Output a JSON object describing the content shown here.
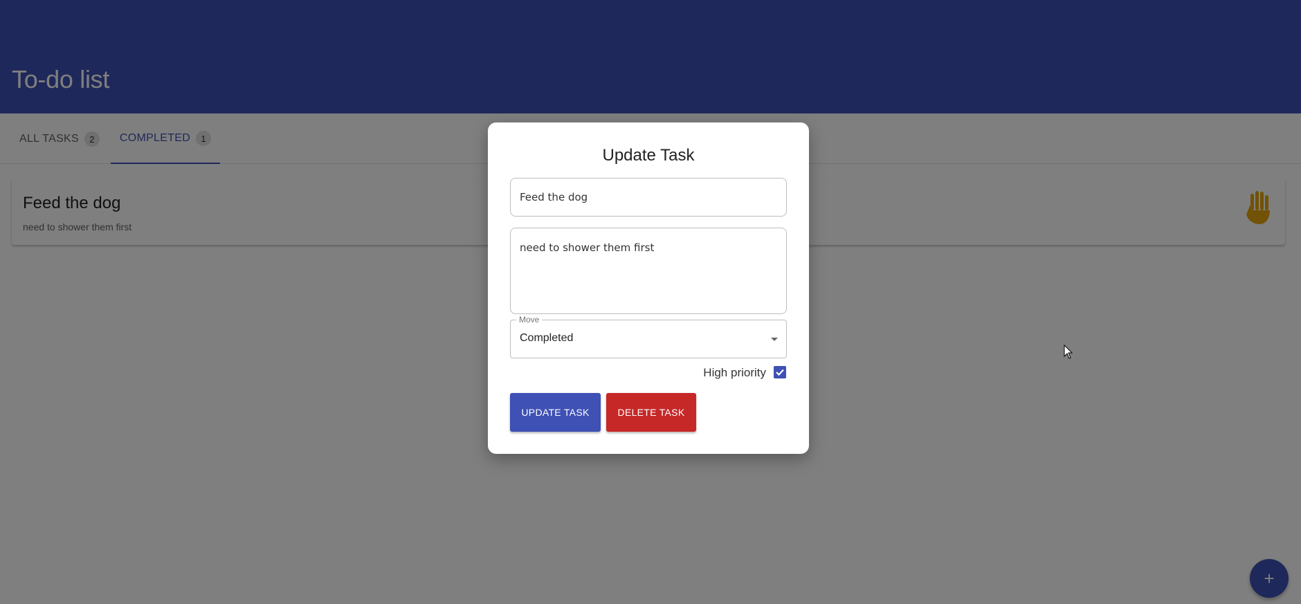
{
  "app": {
    "title": "To-do list",
    "colors": {
      "primary": "#3f51b5",
      "danger": "#c62828",
      "priority": "#e5a50a"
    }
  },
  "tabs": [
    {
      "label": "All tasks",
      "count": "2",
      "active": false
    },
    {
      "label": "Completed",
      "count": "1",
      "active": true
    }
  ],
  "task": {
    "title": "Feed the dog",
    "description": "need to shower them first",
    "priority_icon": "hand-icon"
  },
  "fab": {
    "icon": "plus-icon",
    "label": "+"
  },
  "dialog": {
    "title": "Update Task",
    "task_title_value": "Feed the dog",
    "task_description_value": "need to shower them first",
    "move_label": "Move",
    "move_value": "Completed",
    "high_priority_label": "High priority",
    "high_priority_checked": true,
    "update_button": "Update Task",
    "delete_button": "Delete Task"
  }
}
